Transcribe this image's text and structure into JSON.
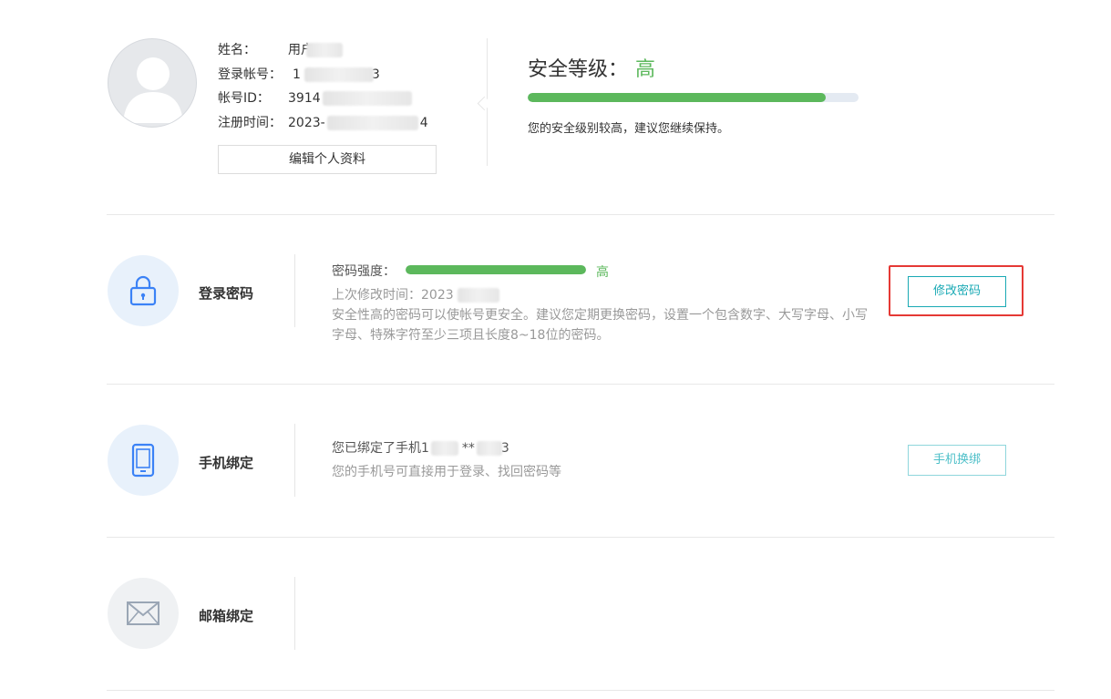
{
  "profile": {
    "name_label": "姓名：",
    "name_value": "用户",
    "account_label": "登录帐号：",
    "account_value_start": "1",
    "account_value_end": "3",
    "id_label": "帐号ID：",
    "id_value": "3914",
    "register_label": "注册时间：",
    "register_value_start": "2023-",
    "register_value_end": "4",
    "edit_button": "编辑个人资料"
  },
  "security": {
    "title": "安全等级：",
    "level": "高",
    "progress_percent": 90,
    "description": "您的安全级别较高，建议您继续保持。"
  },
  "password": {
    "name": "登录密码",
    "strength_label": "密码强度：",
    "strength_level": "高",
    "strength_percent": 100,
    "last_modified_label": "上次修改时间：",
    "last_modified_value": "2023",
    "description": "安全性高的密码可以使帐号更安全。建议您定期更换密码，设置一个包含数字、大写字母、小写字母、特殊字符至少三项且长度8~18位的密码。",
    "button": "修改密码"
  },
  "phone": {
    "name": "手机绑定",
    "bound_prefix": "您已绑定了手机1",
    "bound_mid": "**",
    "bound_end": "3",
    "description": "您的手机号可直接用于登录、找回密码等",
    "button": "手机换绑"
  },
  "email": {
    "name": "邮箱绑定"
  },
  "colors": {
    "green": "#5cb85c",
    "teal": "#19a9b4",
    "highlight_red": "#e53935"
  },
  "icons": [
    "avatar-silhouette-icon",
    "lock-icon",
    "phone-icon",
    "mail-icon"
  ]
}
